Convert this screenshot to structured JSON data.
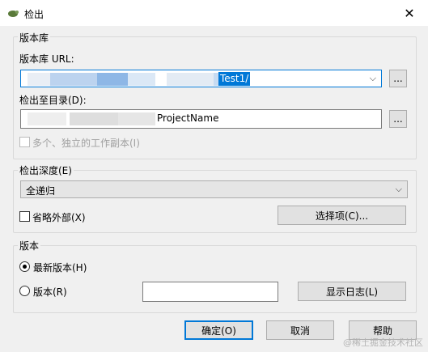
{
  "window": {
    "title": "检出"
  },
  "repository": {
    "group_label": "版本库",
    "url_label": "版本库 URL:",
    "url_value": "Test1/",
    "checkout_dir_label": "检出至目录(D):",
    "checkout_dir_value": "ProjectName",
    "browse_label": "...",
    "multiple_label": "多个、独立的工作副本(I)"
  },
  "depth": {
    "group_label": "检出深度(E)",
    "selected": "全递归",
    "omit_externals_label": "省略外部(X)",
    "options_button": "选择项(C)..."
  },
  "revision": {
    "group_label": "版本",
    "head_label": "最新版本(H)",
    "revision_label": "版本(R)",
    "revision_value": "",
    "show_log_button": "显示日志(L)"
  },
  "buttons": {
    "ok": "确定(O)",
    "cancel": "取消",
    "help": "帮助"
  },
  "watermark": "@稀土掘金技术社区",
  "colors": {
    "accent": "#0078d7",
    "selection": "#0078d7"
  }
}
